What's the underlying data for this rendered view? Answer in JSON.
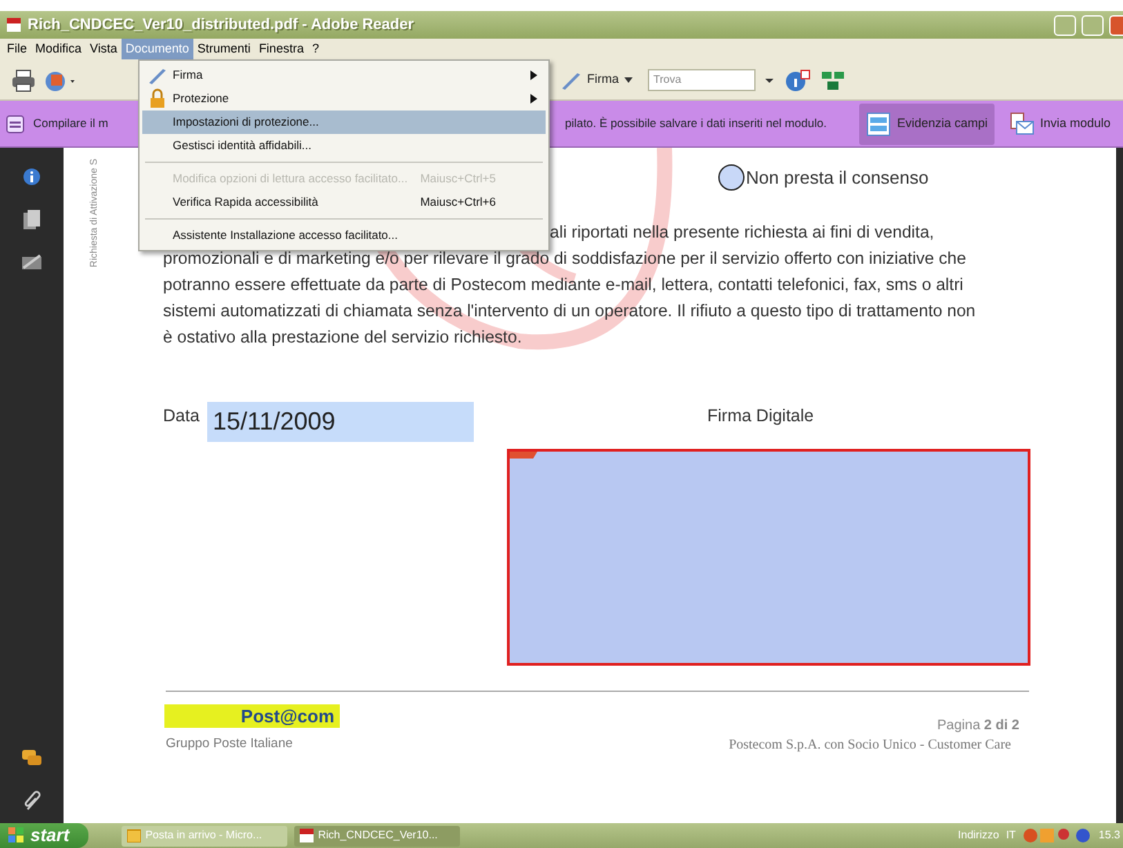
{
  "window": {
    "title": "Rich_CNDCEC_Ver10_distributed.pdf - Adobe Reader"
  },
  "menu_bar": [
    {
      "label": "File",
      "selected": false
    },
    {
      "label": "Modifica",
      "selected": false
    },
    {
      "label": "Vista",
      "selected": false
    },
    {
      "label": "Documento",
      "selected": true
    },
    {
      "label": "Strumenti",
      "selected": false
    },
    {
      "label": "Finestra",
      "selected": false
    },
    {
      "label": "?",
      "selected": false
    }
  ],
  "menu": [
    {
      "kind": "submenu",
      "label": "Firma",
      "selected": false,
      "disabled": false
    },
    {
      "kind": "submenu",
      "label": "Protezione",
      "selected": false,
      "disabled": false
    },
    {
      "kind": "item",
      "label": "Impostazioni di protezione...",
      "selected": true,
      "disabled": false
    },
    {
      "kind": "item",
      "label": "Gestisci identità affidabili...",
      "selected": false,
      "disabled": false
    },
    {
      "kind": "separator"
    },
    {
      "kind": "item",
      "label": "Modifica opzioni di lettura accesso facilitato...",
      "shortcut": "Maiusc+Ctrl+5",
      "selected": false,
      "disabled": true
    },
    {
      "kind": "item",
      "label": "Verifica Rapida accessibilità",
      "shortcut": "Maiusc+Ctrl+6",
      "selected": false,
      "disabled": false
    },
    {
      "kind": "separator"
    },
    {
      "kind": "item",
      "label": "Assistente Installazione accesso facilitato...",
      "selected": false,
      "disabled": false
    }
  ],
  "toolbar": {
    "sign_button": "Firma",
    "find": {
      "placeholder": "Trova"
    }
  },
  "form_bar": {
    "message_left": "Compilare il m",
    "message_right": "pilato. È possibile salvare i dati inseriti nel modulo.",
    "buttons": [
      {
        "label": "Evidenzia campi",
        "kind": "highlight",
        "selected": true
      },
      {
        "label": "Invia modulo",
        "kind": "send",
        "selected": false
      }
    ]
  },
  "document": {
    "side_label": "Richiesta di Attivazione S",
    "radio": {
      "label": "Non presta il consenso",
      "checked": false
    },
    "paragraph_lines": [
      "ali riportati nella presente richiesta ai  fini di vendita,",
      "promozionali e di marketing e/o per rilevare il grado di soddisfazione per il servizio offerto con iniziative che",
      "potranno essere effettuate da parte di Postecom mediante e-mail, lettera, contatti telefonici, fax, sms o  altri",
      "sistemi automatizzati di chiamata senza l'intervento di un operatore. Il rifiuto a questo tipo di trattamento non",
      "è ostativo alla prestazione del servizio richiesto."
    ],
    "date": {
      "label": "Data",
      "value": "15/11/2009"
    },
    "signature": {
      "label": "Firma Digitale"
    },
    "footer": {
      "logo": "Post@com",
      "company": "Gruppo Poste Italiane",
      "page": "Pagina **2 di 2**",
      "legal": "Postecom S.p.A. con Socio Unico - Customer Care"
    }
  },
  "taskbar": {
    "start": "start",
    "tasks": [
      {
        "label": "Posta in arrivo - Micro...",
        "selected": false
      },
      {
        "label": "Rich_CNDCEC_Ver10...",
        "selected": true
      }
    ],
    "address": "Indirizzo",
    "language": "IT",
    "clock": "15.3"
  }
}
